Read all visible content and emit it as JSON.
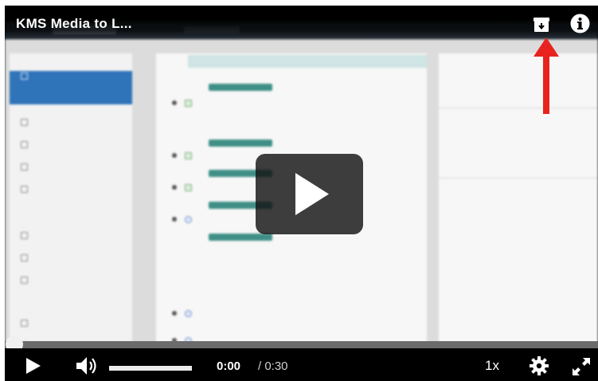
{
  "player": {
    "title": "KMS Media to L...",
    "current_time": "0:00",
    "duration": "/ 0:30",
    "speed": "1x",
    "progress_fraction": 0.0,
    "volume_fraction": 1.0
  },
  "video_frame": {
    "sidebar_items": [],
    "dropzone_text": "",
    "section_title": "",
    "add_link": "",
    "blocks": []
  },
  "colors": {
    "annotation_arrow": "#e8231f",
    "bar_bg": "#000000",
    "progress_track": "#6b6b6b"
  },
  "icons": [
    "download-icon",
    "info-icon",
    "play-icon",
    "volume-icon",
    "settings-gear-icon",
    "fullscreen-icon",
    "big-play-icon",
    "red-arrow-annotation"
  ]
}
